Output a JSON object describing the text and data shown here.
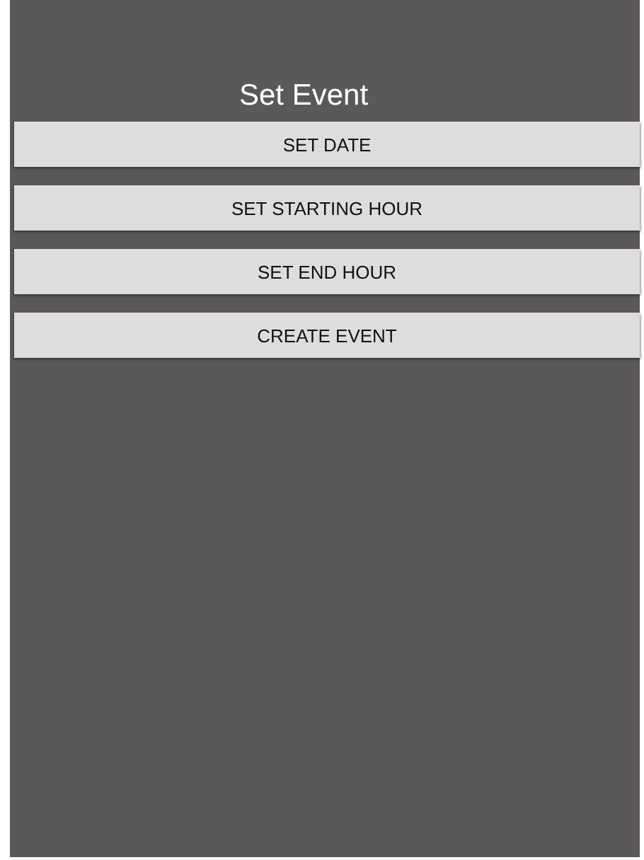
{
  "screen": {
    "title": "Set Event"
  },
  "buttons": [
    {
      "label": "SET DATE"
    },
    {
      "label": "SET STARTING HOUR"
    },
    {
      "label": "SET END HOUR"
    },
    {
      "label": "CREATE EVENT"
    }
  ]
}
